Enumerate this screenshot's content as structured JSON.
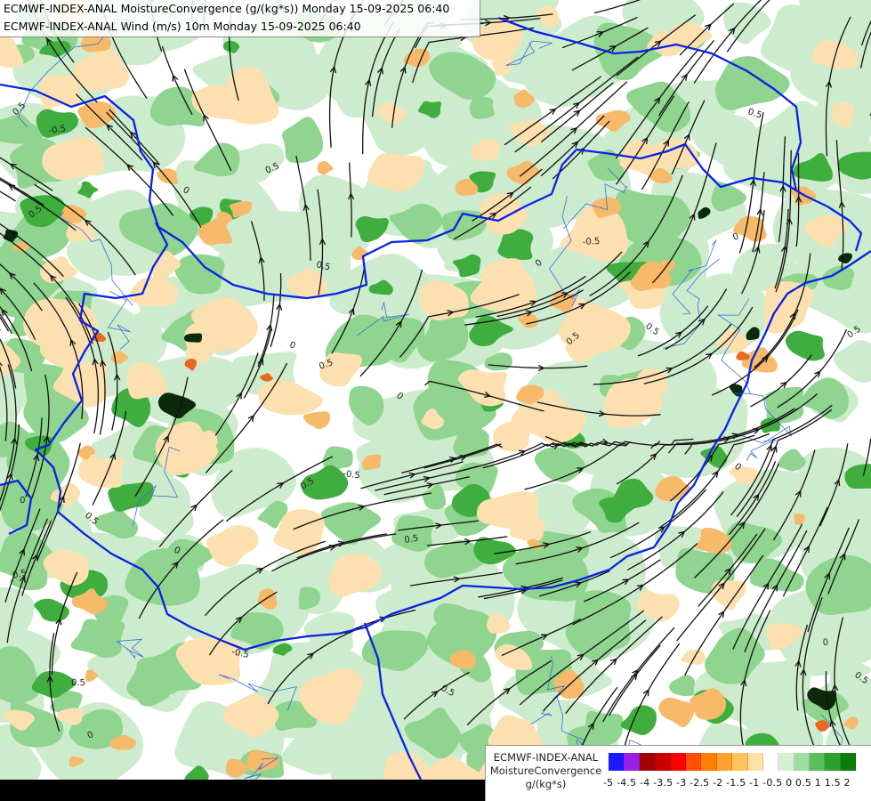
{
  "title": {
    "line1": "ECMWF-INDEX-ANAL MoistureConvergence (g/(kg*s)) Monday 15-09-2025 06:40",
    "line2": "ECMWF-INDEX-ANAL Wind (m/s) 10m Monday 15-09-2025 06:40"
  },
  "legend": {
    "source": "ECMWF-INDEX-ANAL",
    "variable": "MoistureConvergence",
    "unit": "g/(kg*s)",
    "tick_labels": "-5 -4.5 -4 -3.5 -3 -2.5 -2 -1.5 -1 -0.5 0 0.5 1 1.5 2",
    "colors": [
      "#1a1aff",
      "#9b1ee6",
      "#a30000",
      "#c80000",
      "#ff0000",
      "#ff4f00",
      "#ff7f00",
      "#ffa12e",
      "#ffc35e",
      "#ffe1a8",
      "#ffffff",
      "#d4efd4",
      "#9fdc9f",
      "#5bbf5b",
      "#2ea02e",
      "#0a7d0a"
    ]
  },
  "contour_labels": [
    "0.5",
    "-0.5",
    "0"
  ],
  "map_colors": {
    "border": "#0a22e6",
    "river": "#3b6ed9",
    "streamline": "#111111",
    "conv_light": "#cdeccd",
    "conv_mid": "#8fd48f",
    "conv_strong": "#3fae3f",
    "div_light": "#fde0b0",
    "div_mid": "#f7b96a",
    "div_strong": "#e86a1e"
  }
}
